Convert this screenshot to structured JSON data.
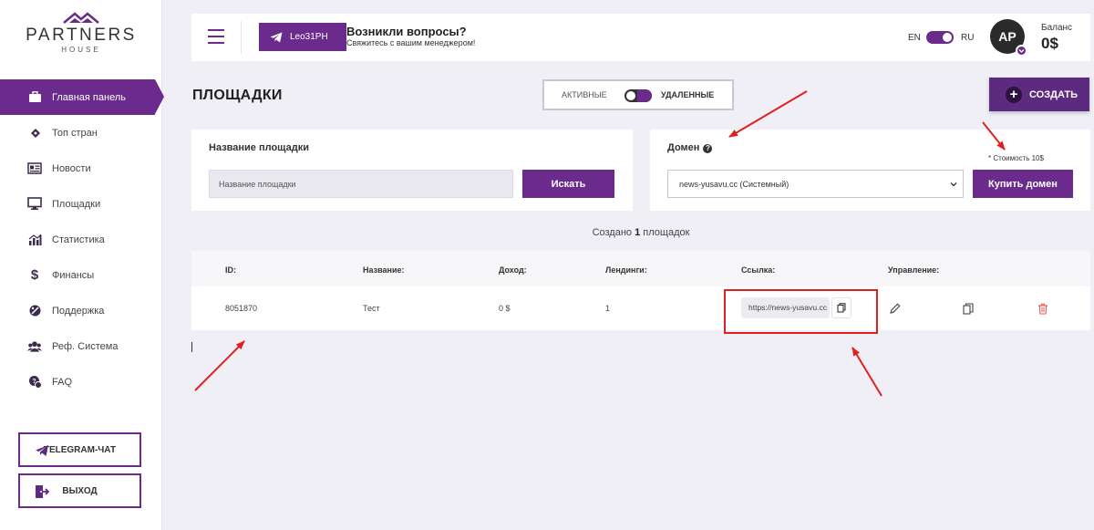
{
  "logo": {
    "main": "PARTNERS",
    "sub": "HOUSE",
    "color": "#6a2b8d"
  },
  "sidebar": {
    "items": [
      {
        "label": "Главная панель",
        "icon": "briefcase-icon",
        "active": true
      },
      {
        "label": "Топ стран",
        "icon": "ticket-icon"
      },
      {
        "label": "Новости",
        "icon": "newspaper-icon"
      },
      {
        "label": "Площадки",
        "icon": "monitor-icon"
      },
      {
        "label": "Статистика",
        "icon": "chart-icon"
      },
      {
        "label": "Финансы",
        "icon": "dollar-icon"
      },
      {
        "label": "Поддержка",
        "icon": "support-icon"
      },
      {
        "label": "Реф. Система",
        "icon": "users-icon"
      },
      {
        "label": "FAQ",
        "icon": "faq-icon"
      }
    ],
    "telegram_chat": "TELEGRAM-ЧАТ",
    "logout": "ВЫХОД"
  },
  "header": {
    "telegram_user": "Leo31PH",
    "question_title": "Возникли вопросы?",
    "question_sub": "Свяжитесь с вашим менеджером!",
    "lang_en": "EN",
    "lang_ru": "RU",
    "avatar": "AP",
    "balance_label": "Баланс",
    "balance_value": "0$"
  },
  "page": {
    "title": "ПЛОЩАДКИ",
    "filter_active": "АКТИВНЫЕ",
    "filter_deleted": "УДАЛЕННЫЕ",
    "create": "СОЗДАТЬ"
  },
  "search": {
    "label": "Название площадки",
    "placeholder": "Название площадки",
    "button": "Искать"
  },
  "domain": {
    "label": "Домен",
    "selected": "news-yusavu.cc (Системный)",
    "button": "Купить домен",
    "cost_note": "* Стоимость 10$"
  },
  "summary": {
    "prefix": "Создано",
    "count": "1",
    "suffix": "площадок"
  },
  "table": {
    "columns": [
      "ID:",
      "Название:",
      "Доход:",
      "Лендинги:",
      "Ссылка:",
      "Управление:"
    ],
    "rows": [
      {
        "id": "8051870",
        "name": "Тест",
        "income": "0 $",
        "landings": "1",
        "link": "https://news-yusavu.cc"
      }
    ]
  },
  "colors": {
    "accent": "#6a2b8d",
    "annotation": "#e02020",
    "delete": "#e05a5a"
  }
}
